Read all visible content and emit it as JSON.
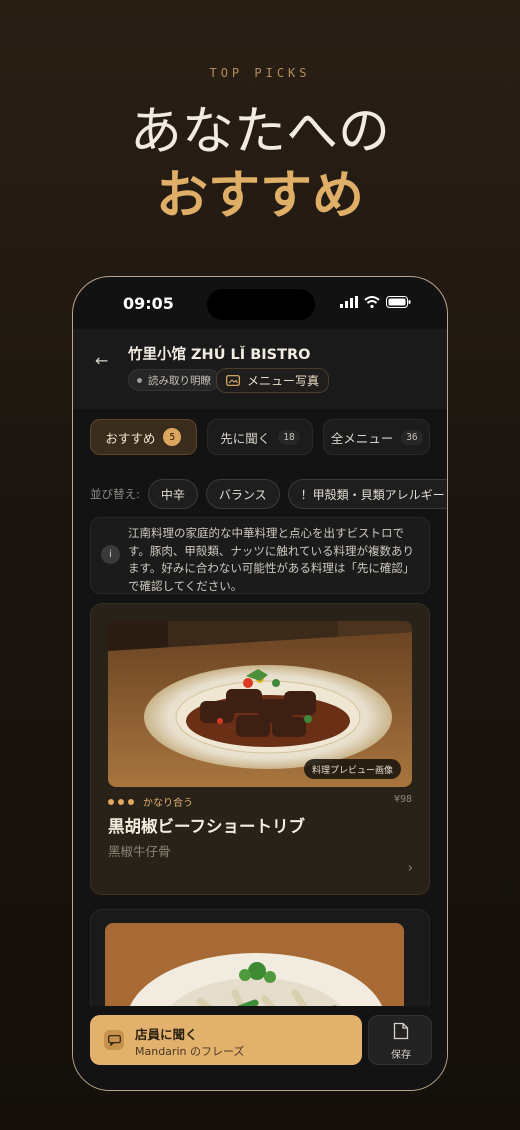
{
  "hero": {
    "kicker": "TOP PICKS",
    "title_line1": "あなたへの",
    "title_line2": "おすすめ"
  },
  "status_bar": {
    "time": "09:05",
    "icons": [
      "signal-icon",
      "wifi-icon",
      "battery-icon"
    ]
  },
  "header": {
    "back_icon": "arrow-left-icon",
    "restaurant_name": "竹里小馆 ZHÚ LǏ BISTRO",
    "readability_badge": "読み取り明瞭",
    "menu_photo_label": "メニュー写真"
  },
  "tabs": [
    {
      "label": "おすすめ",
      "count": "5",
      "active": true
    },
    {
      "label": "先に聞く",
      "count": "18",
      "active": false
    },
    {
      "label": "全メニュー",
      "count": "36",
      "active": false
    }
  ],
  "sort": {
    "label": "並び替え:",
    "chips": [
      "中辛",
      "バランス",
      "！甲殻類・貝類アレルギー",
      "！"
    ]
  },
  "info": {
    "icon": "i",
    "text": "江南料理の家庭的な中華料理と点心を出すビストロです。豚肉、甲殻類、ナッツに触れている料理が複数あります。好みに合わない可能性がある料理は「先に確認」で確認してください。"
  },
  "cards": [
    {
      "photo_tag": "料理プレビュー画像",
      "match_level": 3,
      "match_label": "かなり合う",
      "price": "¥98",
      "name": "黒胡椒ビーフショートリブ",
      "name_original": "黑椒牛仔骨"
    }
  ],
  "bottom": {
    "ask_title": "店員に聞く",
    "ask_subtitle": "Mandarin のフレーズ",
    "save_label": "保存"
  },
  "colors": {
    "accent": "#e2b26d",
    "background": "#131313",
    "card": "#282218"
  }
}
